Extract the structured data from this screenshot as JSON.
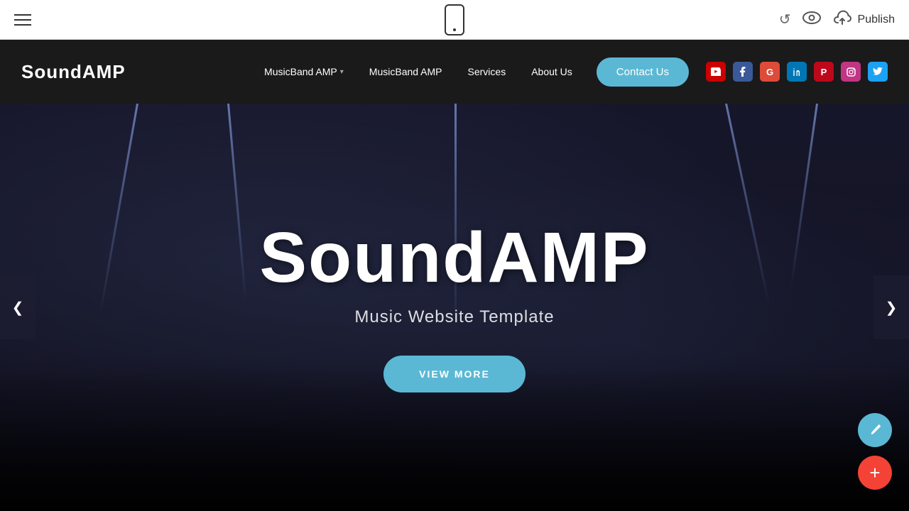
{
  "toolbar": {
    "publish_label": "Publish"
  },
  "site": {
    "logo": "SoundAMP",
    "nav": {
      "item1": "MusicBand AMP",
      "item2": "MusicBand AMP",
      "item3": "Services",
      "item4": "About Us",
      "contact_btn": "Contact Us"
    },
    "social": {
      "youtube": "▶",
      "facebook": "f",
      "google": "G",
      "linkedin": "in",
      "pinterest": "P",
      "instagram": "📷",
      "twitter": "🐦"
    }
  },
  "hero": {
    "title": "SoundAMP",
    "subtitle": "Music Website Template",
    "cta": "VIEW MORE",
    "arrow_left": "❮",
    "arrow_right": "❯"
  },
  "fab": {
    "edit_icon": "✎",
    "add_icon": "+"
  }
}
